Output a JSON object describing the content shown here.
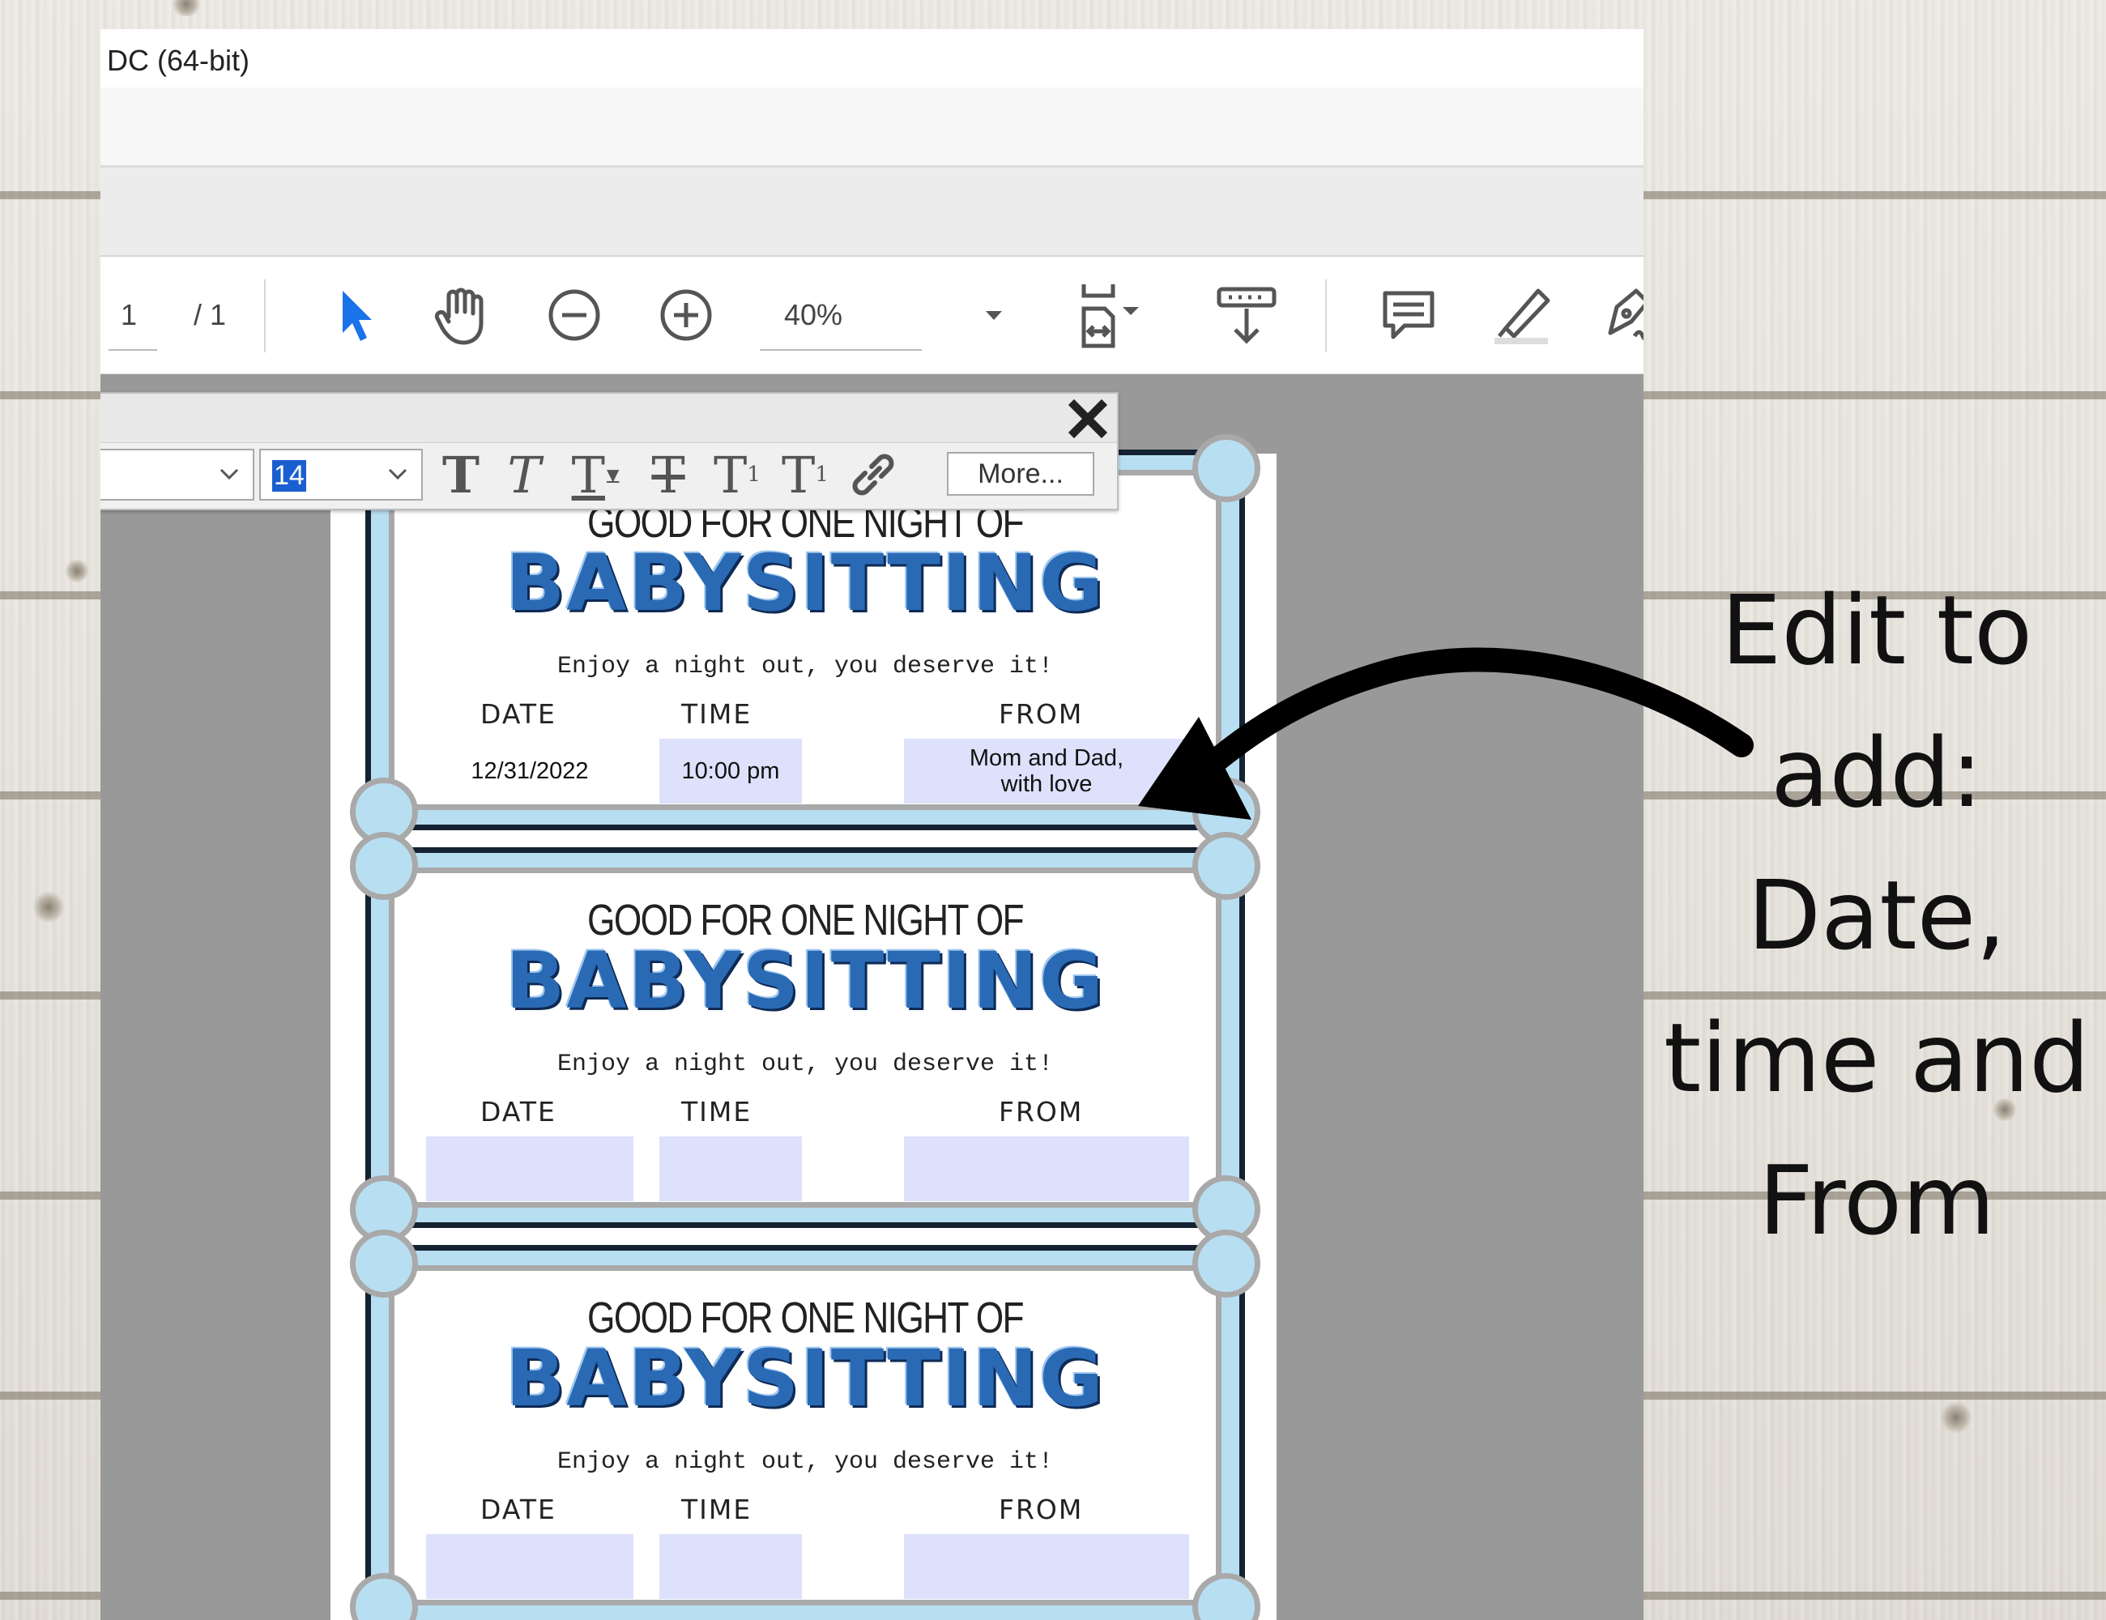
{
  "window": {
    "title": "DC (64-bit)"
  },
  "toolbar": {
    "page_current": "1",
    "page_total": "/ 1",
    "zoom": "40%",
    "icons": [
      "select-arrow-icon",
      "hand-tool-icon",
      "zoom-out-icon",
      "zoom-in-icon",
      "fit-page-icon",
      "scroll-mode-icon",
      "comment-icon",
      "highlight-icon",
      "sign-icon",
      "more-tools-icon"
    ]
  },
  "format_bar": {
    "font_size": "14",
    "more_label": "More...",
    "text_tools": [
      "T",
      "T",
      "T",
      "T",
      "T",
      "T"
    ]
  },
  "tickets": [
    {
      "headline": "GOOD FOR ONE NIGHT OF",
      "title": "BABYSITTING",
      "subtitle": "Enjoy a night out, you deserve it!",
      "date_label": "DATE",
      "time_label": "TIME",
      "from_label": "FROM",
      "date_value": "12/31/2022",
      "time_value": "10:00 pm",
      "from_line1": "Mom and Dad,",
      "from_line2": "with love"
    },
    {
      "headline": "GOOD FOR ONE NIGHT OF",
      "title": "BABYSITTING",
      "subtitle": "Enjoy a night out, you deserve it!",
      "date_label": "DATE",
      "time_label": "TIME",
      "from_label": "FROM"
    },
    {
      "headline": "GOOD FOR ONE NIGHT OF",
      "title": "BABYSITTING",
      "subtitle": "Enjoy a night out, you deserve it!",
      "date_label": "DATE",
      "time_label": "TIME",
      "from_label": "FROM"
    }
  ],
  "annotation": {
    "lines": [
      "Edit to",
      "add:",
      "Date,",
      "time and",
      "From"
    ]
  },
  "colors": {
    "ticket_fill": "#b8def1",
    "ticket_border": "#142231",
    "field_fill": "#dde1fb",
    "title_blue": "#2a6ab5",
    "select_blue": "#1a73e8"
  }
}
